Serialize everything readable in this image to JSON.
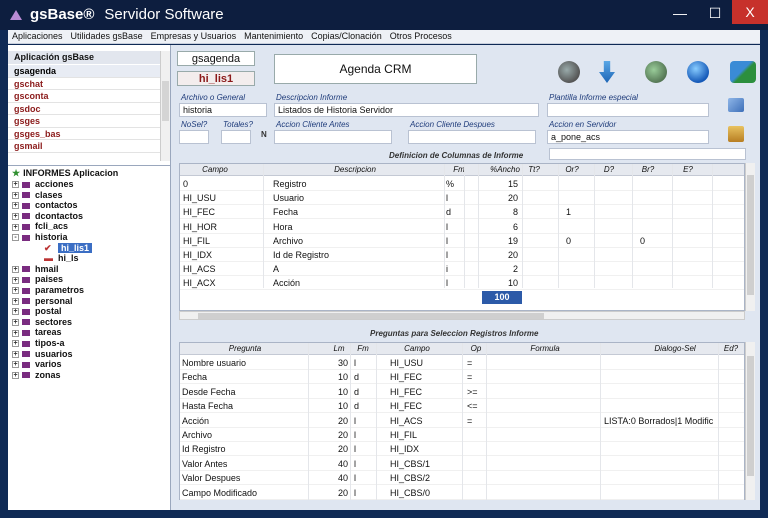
{
  "window": {
    "app_name": "gsBase®",
    "title": "Servidor Software",
    "min": "—",
    "max": "☐",
    "close": "X"
  },
  "menu": [
    "Aplicaciones",
    "Utilidades gsBase",
    "Empresas y Usuarios",
    "Mantenimiento",
    "Copias/Clonación",
    "Otros Procesos"
  ],
  "apps": {
    "header": "Aplicación gsBase",
    "items": [
      "gsagenda",
      "gschat",
      "gsconta",
      "gsdoc",
      "gsges",
      "gsges_bas",
      "gsmail"
    ],
    "selected": 0
  },
  "tree": {
    "root": "INFORMES Aplicacion",
    "items": [
      {
        "label": "acciones",
        "lvl": 0,
        "box": "+"
      },
      {
        "label": "clases",
        "lvl": 0,
        "box": "+"
      },
      {
        "label": "contactos",
        "lvl": 0,
        "box": "+"
      },
      {
        "label": "dcontactos",
        "lvl": 0,
        "box": "+"
      },
      {
        "label": "fcli_acs",
        "lvl": 0,
        "box": "+"
      },
      {
        "label": "historia",
        "lvl": 0,
        "box": "-"
      },
      {
        "label": "hi_lis1",
        "lvl": 1,
        "box": "",
        "sel": true
      },
      {
        "label": "hi_ls",
        "lvl": 1,
        "box": ""
      },
      {
        "label": "hmail",
        "lvl": 0,
        "box": "+"
      },
      {
        "label": "paises",
        "lvl": 0,
        "box": "+"
      },
      {
        "label": "parametros",
        "lvl": 0,
        "box": "+"
      },
      {
        "label": "personal",
        "lvl": 0,
        "box": "+"
      },
      {
        "label": "postal",
        "lvl": 0,
        "box": "+"
      },
      {
        "label": "sectores",
        "lvl": 0,
        "box": "+"
      },
      {
        "label": "tareas",
        "lvl": 0,
        "box": "+"
      },
      {
        "label": "tipos-a",
        "lvl": 0,
        "box": "+"
      },
      {
        "label": "usuarios",
        "lvl": 0,
        "box": "+"
      },
      {
        "label": "varios",
        "lvl": 0,
        "box": "+"
      },
      {
        "label": "zonas",
        "lvl": 0,
        "box": "+"
      }
    ]
  },
  "top": {
    "tab1": "gsagenda",
    "tab2": "hi_lis1",
    "title": "Agenda CRM"
  },
  "form": {
    "archivo_label": "Archivo o General",
    "archivo": "historia",
    "descripcion_label": "Descripcion Informe",
    "descripcion": "Listados de Historia Servidor",
    "plantilla_label": "Plantilla Informe especial",
    "plantilla": "",
    "nosel_label": "NoSel?",
    "totales_label": "Totales?",
    "n_label": "N",
    "acc_antes_label": "Accion Cliente Antes",
    "acc_despues_label": "Accion Cliente Despues",
    "acc_servidor_label": "Accion en Servidor",
    "acc_servidor": "a_pone_acs"
  },
  "cols_section": "Definicion de Columnas de Informe",
  "cols_headers": [
    "Campo",
    "Descripcion",
    "Fm",
    "%Ancho",
    "Tt?",
    "Or?",
    "D?",
    "Br?",
    "E?"
  ],
  "cols_rows": [
    [
      "0",
      "Registro",
      "%",
      "15",
      "",
      "",
      "",
      "",
      ""
    ],
    [
      "HI_USU",
      "Usuario",
      "l",
      "20",
      "",
      "",
      "",
      "",
      ""
    ],
    [
      "HI_FEC",
      "Fecha",
      "d",
      "8",
      "",
      "1",
      "",
      "",
      ""
    ],
    [
      "HI_HOR",
      "Hora",
      "l",
      "6",
      "",
      "",
      "",
      "",
      ""
    ],
    [
      "HI_FIL",
      "Archivo",
      "l",
      "19",
      "",
      "0",
      "",
      "0",
      ""
    ],
    [
      "HI_IDX",
      "Id de Registro",
      "l",
      "20",
      "",
      "",
      "",
      "",
      ""
    ],
    [
      "HI_ACS",
      "A",
      "i",
      "2",
      "",
      "",
      "",
      "",
      ""
    ],
    [
      "HI_ACX",
      "Acción",
      "l",
      "10",
      "",
      "",
      "",
      "",
      ""
    ]
  ],
  "cols_total": "100",
  "preg_section": "Preguntas para Seleccion Registros Informe",
  "preg_headers": [
    "Pregunta",
    "Lm",
    "Fm",
    "Campo",
    "Op",
    "Formula",
    "Dialogo-Sel",
    "Ed?"
  ],
  "preg_rows": [
    [
      "Nombre usuario",
      "30",
      "l",
      "HI_USU",
      "=",
      "",
      ""
    ],
    [
      "Fecha",
      "10",
      "d",
      "HI_FEC",
      "=",
      "",
      ""
    ],
    [
      "Desde Fecha",
      "10",
      "d",
      "HI_FEC",
      ">=",
      "",
      ""
    ],
    [
      "Hasta Fecha",
      "10",
      "d",
      "HI_FEC",
      "<=",
      "",
      ""
    ],
    [
      "Acción",
      "20",
      "l",
      "HI_ACS",
      "=",
      "",
      "LISTA:0 Borrados|1 Modific"
    ],
    [
      "Archivo",
      "20",
      "l",
      "HI_FIL",
      "",
      "",
      ""
    ],
    [
      "Id Registro",
      "20",
      "l",
      "HI_IDX",
      "",
      "",
      ""
    ],
    [
      "Valor Antes",
      "40",
      "l",
      "HI_CBS/1",
      "",
      "",
      ""
    ],
    [
      "Valor Despues",
      "40",
      "l",
      "HI_CBS/2",
      "",
      "",
      ""
    ],
    [
      "Campo Modificado",
      "20",
      "l",
      "HI_CBS/0",
      "",
      "",
      ""
    ]
  ],
  "icons": [
    "delete-db-icon",
    "download-arrow-icon",
    "add-db-icon",
    "next-circle-icon",
    "users-icon",
    "copy-icon",
    "clipboard-icon"
  ]
}
